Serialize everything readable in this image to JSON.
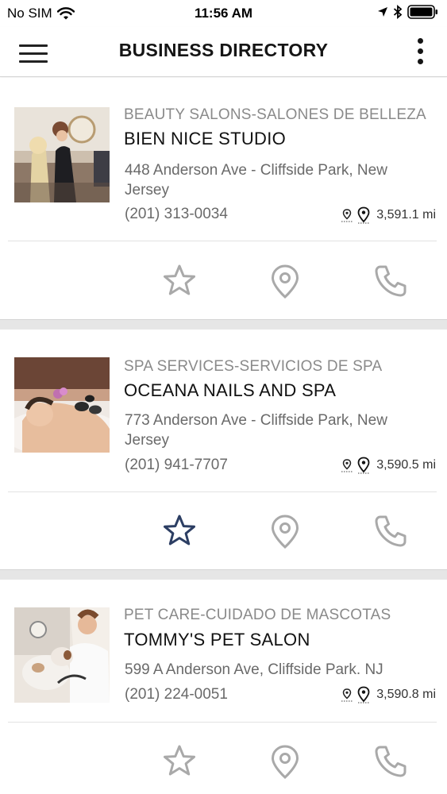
{
  "status_bar": {
    "carrier": "No SIM",
    "time": "11:56 AM"
  },
  "header": {
    "title": "BUSINESS DIRECTORY"
  },
  "listings": [
    {
      "category": "BEAUTY SALONS-SALONES DE BELLEZA",
      "name": "BIEN NICE STUDIO",
      "address": "448 Anderson Ave - Cliffside Park, New Jersey",
      "phone": "(201) 313-0034",
      "distance": "3,591.1 mi",
      "favorited": false
    },
    {
      "category": "SPA SERVICES-SERVICIOS DE SPA",
      "name": "OCEANA NAILS AND SPA",
      "address": "773 Anderson Ave - Cliffside Park, New Jersey",
      "phone": "(201) 941-7707",
      "distance": "3,590.5 mi",
      "favorited": true
    },
    {
      "category": "PET CARE-CUIDADO DE MASCOTAS",
      "name": "TOMMY'S PET SALON",
      "address": "599 A Anderson Ave, Cliffside Park. NJ",
      "phone": "(201) 224-0051",
      "distance": "3,590.8 mi",
      "favorited": false
    }
  ],
  "colors": {
    "icon_gray": "#a9a9a9",
    "favorite_active": "#2c3e63",
    "separator": "#e6e6e6"
  }
}
